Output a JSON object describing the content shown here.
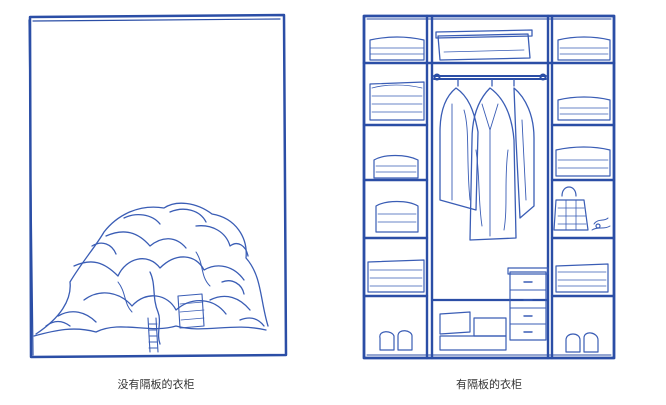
{
  "captions": {
    "left": "没有隔板的衣柜",
    "right": "有隔板的衣柜"
  },
  "colors": {
    "ink": "#2b4ea6",
    "ink_light": "#4a6cc0",
    "background": "#ffffff",
    "caption_text": "#333333"
  }
}
